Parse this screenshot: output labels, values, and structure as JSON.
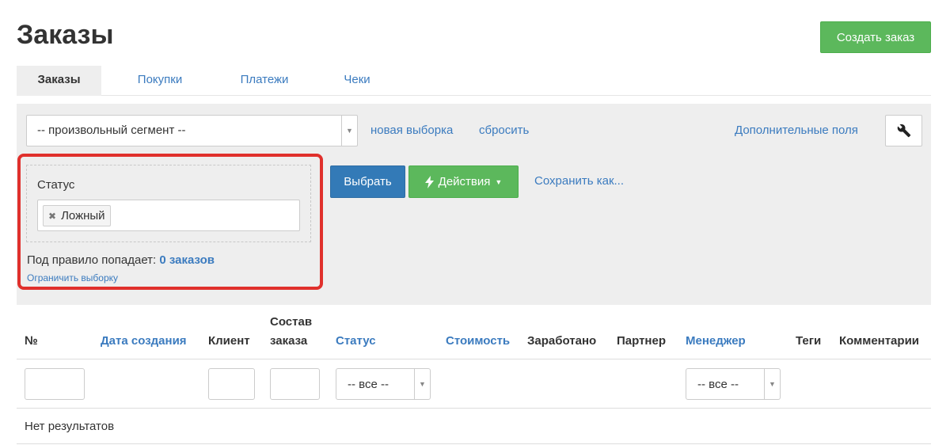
{
  "header": {
    "title": "Заказы",
    "create_button": "Создать заказ"
  },
  "tabs": [
    {
      "label": "Заказы",
      "active": true
    },
    {
      "label": "Покупки",
      "active": false
    },
    {
      "label": "Платежи",
      "active": false
    },
    {
      "label": "Чеки",
      "active": false
    }
  ],
  "filter": {
    "segment_value": "-- произвольный сегмент --",
    "new_selection": "новая выборка",
    "reset": "сбросить",
    "extra_fields": "Дополнительные поля",
    "rule": {
      "field_label": "Статус",
      "tag_value": "Ложный",
      "count_prefix": "Под правило попадает:",
      "count_value": "0 заказов",
      "limit_link": "Ограничить выборку"
    },
    "select_button": "Выбрать",
    "actions_button": "Действия",
    "save_as": "Сохранить как..."
  },
  "table": {
    "columns": {
      "number": "№",
      "created": "Дата создания",
      "client": "Клиент",
      "composition_line1": "Состав",
      "composition_line2": "заказа",
      "status": "Статус",
      "cost": "Стоимость",
      "earned": "Заработано",
      "partner": "Партнер",
      "manager": "Менеджер",
      "tags": "Теги",
      "comments": "Комментарии"
    },
    "status_filter": "-- все --",
    "manager_filter": "-- все --",
    "empty_text": "Нет результатов"
  },
  "colors": {
    "primary": "#337ab7",
    "success": "#5cb85c",
    "link": "#3b7bbf",
    "highlight": "#e0302c"
  }
}
